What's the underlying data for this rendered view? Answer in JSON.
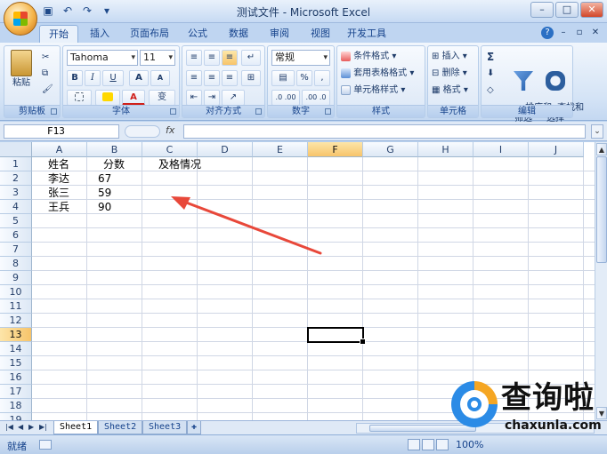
{
  "window": {
    "title": "测试文件 - Microsoft Excel"
  },
  "qat_icons": [
    "save-icon",
    "undo-icon",
    "redo-icon",
    "customize-icon"
  ],
  "tabs": [
    "开始",
    "插入",
    "页面布局",
    "公式",
    "数据",
    "审阅",
    "视图",
    "开发工具"
  ],
  "active_tab": "开始",
  "ribbon": {
    "clipboard": {
      "paste": "粘贴",
      "label": "剪贴板"
    },
    "font": {
      "name": "Tahoma",
      "size": "11",
      "label": "字体",
      "bold": "B",
      "italic": "I",
      "underline": "U",
      "grow": "A",
      "shrink": "A",
      "font_color": "A",
      "phonetic": "变"
    },
    "alignment": {
      "label": "对齐方式"
    },
    "number": {
      "format": "常规",
      "percent": "%",
      "comma": ",",
      "inc_dec": ".0 .00",
      "dec_dec": ".00 .0",
      "label": "数字"
    },
    "styles": {
      "conditional": "条件格式",
      "table": "套用表格格式",
      "cell": "单元格样式",
      "label": "样式"
    },
    "cells": {
      "insert": "插入",
      "delete": "删除",
      "format": "格式",
      "label": "单元格"
    },
    "editing": {
      "sum": "Σ",
      "sort": "排序和\n筛选",
      "find": "查找和\n选择",
      "label": "编辑"
    }
  },
  "formula_bar": {
    "name_box": "F13",
    "fx": "fx",
    "value": ""
  },
  "columns": [
    "A",
    "B",
    "C",
    "D",
    "E",
    "F",
    "G",
    "H",
    "I",
    "J"
  ],
  "selected_column": "F",
  "rows": [
    "1",
    "2",
    "3",
    "4",
    "5",
    "6",
    "7",
    "8",
    "9",
    "10",
    "11",
    "12",
    "13",
    "14",
    "15",
    "16",
    "17",
    "18",
    "19"
  ],
  "selected_row": "13",
  "cells": {
    "A1": "姓名",
    "B1": "分数",
    "C1": "及格情况",
    "A2": "李达",
    "B2": "67",
    "A3": "张三",
    "B3": "59",
    "A4": "王兵",
    "B4": "90"
  },
  "sheets": [
    "Sheet1",
    "Sheet2",
    "Sheet3"
  ],
  "active_sheet": "Sheet1",
  "status": {
    "text": "就绪",
    "zoom": "100%"
  },
  "watermark": {
    "title": "查询啦",
    "url": "chaxunla.com"
  },
  "colors": {
    "arrow": "#e8483a",
    "accent": "#2b8be6",
    "selected_header": "#f7c46a"
  }
}
